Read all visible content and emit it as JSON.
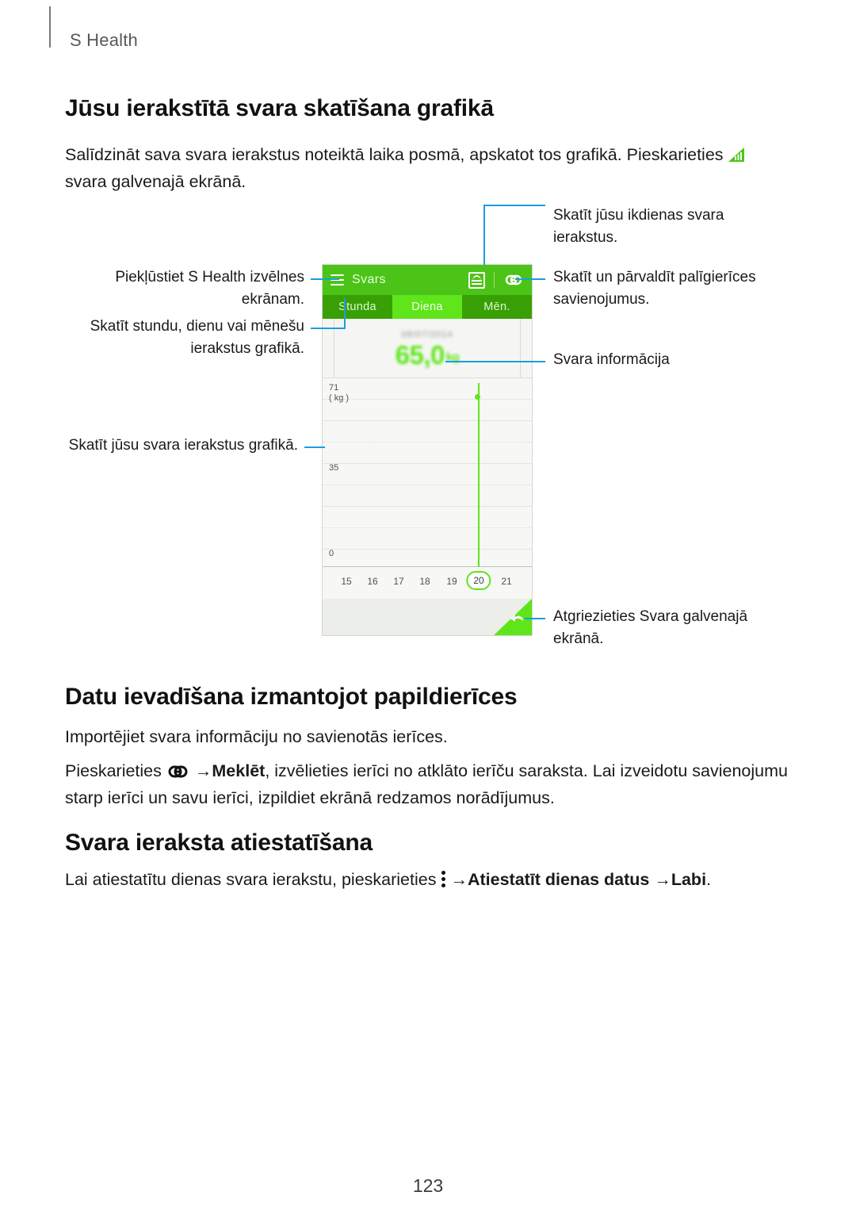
{
  "breadcrumb": "S Health",
  "page_number": "123",
  "colors": {
    "accent_green": "#4CC417",
    "active_green": "#5FE519",
    "tab_green": "#38A004",
    "leader_blue": "#1E9CE0"
  },
  "sections": {
    "graph": {
      "title": "Jūsu ierakstītā svara skatīšana grafikā",
      "intro_part1": "Salīdzināt sava svara ierakstus noteiktā laika posmā, apskatot tos grafikā. Pieskarieties",
      "intro_icon": "chart-triangle-icon",
      "intro_part2": "svara galvenajā ekrānā."
    },
    "accessory": {
      "title": "Datu ievadīšana izmantojot papildierīces",
      "para1": "Importējiet svara informāciju no savienotās ierīces.",
      "para2_part1": "Pieskarieties",
      "para2_icon": "link-icon",
      "para2_arrow": "→",
      "para2_bold": "Meklēt",
      "para2_part2": ", izvēlieties ierīci no atklāto ierīču saraksta. Lai izveidotu savienojumu starp ierīci un savu ierīci, izpildiet ekrānā redzamos norādījumus."
    },
    "reset": {
      "title": "Svara ieraksta atiestatīšana",
      "para_part1": "Lai atiestatītu dienas svara ierakstu, pieskarieties",
      "para_icon": "more-options-icon",
      "para_arrow1": "→",
      "para_bold1": "Atiestatīt dienas datus",
      "para_arrow2": "→",
      "para_bold2": "Labi",
      "para_end": "."
    }
  },
  "device": {
    "app_bar": {
      "menu_icon": "hamburger-icon",
      "title": "Svars",
      "record_icon": "record-chart-icon",
      "link_icon": "link-icon"
    },
    "tabs": [
      {
        "label": "Stunda",
        "active": false
      },
      {
        "label": "Diena",
        "active": true
      },
      {
        "label": "Mēn.",
        "active": false
      }
    ],
    "summary": {
      "date": "08/07/2014",
      "value": "65,0",
      "unit": "kg"
    },
    "nav": {
      "back_icon": "back-arrow-icon"
    }
  },
  "chart_data": {
    "type": "line",
    "title": "",
    "xlabel": "",
    "ylabel": "( kg )",
    "categories": [
      "15",
      "16",
      "17",
      "18",
      "19",
      "20",
      "21"
    ],
    "values": [
      null,
      null,
      null,
      null,
      null,
      65.0,
      null
    ],
    "ylim": [
      0,
      71
    ],
    "ytick_labels": [
      "71",
      "35",
      "0"
    ],
    "ytick_values": [
      71,
      35,
      0
    ],
    "highlighted_category": "20",
    "grid": true,
    "legend": "none",
    "series_color": "#5FE519"
  },
  "callouts": {
    "left": [
      {
        "id": "menu",
        "text": "Piekļūstiet S Health izvēlnes ekrānam."
      },
      {
        "id": "period",
        "text": "Skatīt stundu, dienu vai mēnešu ierakstus grafikā."
      },
      {
        "id": "graph",
        "text": "Skatīt jūsu svara ierakstus grafikā."
      }
    ],
    "right": [
      {
        "id": "daily",
        "text": "Skatīt jūsu ikdienas svara ierakstus."
      },
      {
        "id": "accessories",
        "text": "Skatīt un pārvaldīt palīgierīces savienojumus."
      },
      {
        "id": "info",
        "text": "Svara informācija"
      },
      {
        "id": "back",
        "text": "Atgriezieties Svara galvenajā ekrānā."
      }
    ]
  }
}
